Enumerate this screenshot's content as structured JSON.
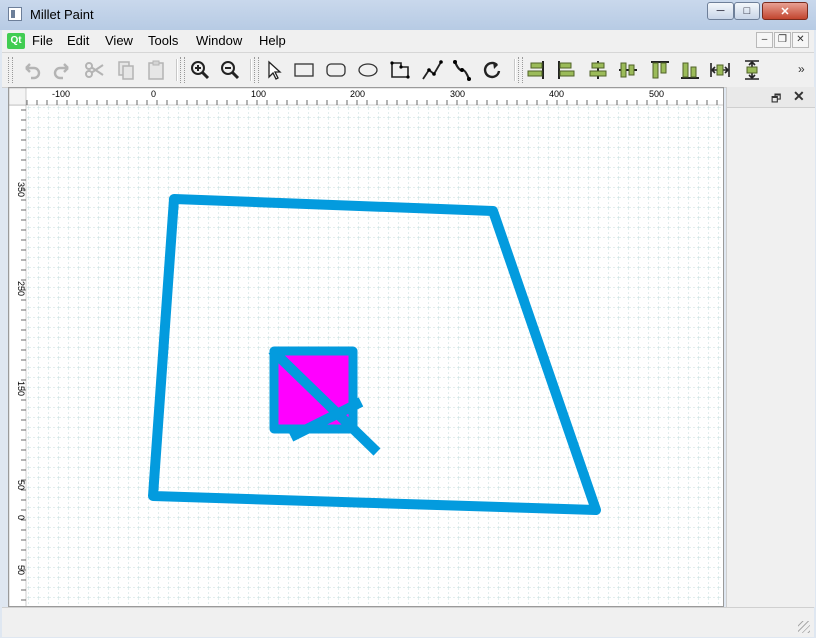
{
  "window": {
    "title": "Millet Paint",
    "app_icon": "window-icon"
  },
  "window_controls": {
    "minimize": "─",
    "maximize": "□",
    "close": "✕"
  },
  "menubar": {
    "logo": "Qt",
    "items": [
      "File",
      "Edit",
      "View",
      "Tools",
      "Window",
      "Help"
    ],
    "mdi_controls": {
      "minimize": "–",
      "restore": "❐",
      "close": "✕"
    }
  },
  "toolbar": {
    "icons": [
      "undo-icon",
      "redo-icon",
      "cut-icon",
      "copy-icon",
      "paste-icon",
      "zoom-in-icon",
      "zoom-out-icon",
      "select-arrow-icon",
      "rectangle-icon",
      "rounded-rectangle-icon",
      "ellipse-icon",
      "polygon-icon",
      "polyline-icon",
      "bezier-icon",
      "rotate-icon",
      "align-right-icon",
      "align-left-icon",
      "align-hcenter-icon",
      "align-vcenter-icon",
      "align-top-icon",
      "align-bottom-icon",
      "same-width-icon",
      "same-height-icon"
    ],
    "more": "»"
  },
  "rulers": {
    "horizontal_labels": [
      "-100",
      "0",
      "100",
      "200",
      "300",
      "400",
      "500"
    ],
    "vertical_labels": [
      "350",
      "250",
      "150",
      "50",
      "0",
      "50"
    ]
  },
  "canvas": {
    "shapes": [
      {
        "type": "polygon",
        "name": "quadrilateral",
        "stroke": "#039bde",
        "fill": "none"
      },
      {
        "type": "rectangle",
        "name": "magenta-square",
        "stroke": "#039bde",
        "fill": "#ff00ff"
      },
      {
        "type": "line",
        "name": "diagonal-line-1",
        "stroke": "#039bde"
      },
      {
        "type": "line",
        "name": "diagonal-line-2",
        "stroke": "#039bde"
      }
    ],
    "grid_color": "#c6dede"
  },
  "dock": {
    "float_label": "🗗",
    "close_label": "✕"
  },
  "colors": {
    "accent": "#039bde",
    "fill": "#ff00ff",
    "qt_green": "#41cd52"
  }
}
